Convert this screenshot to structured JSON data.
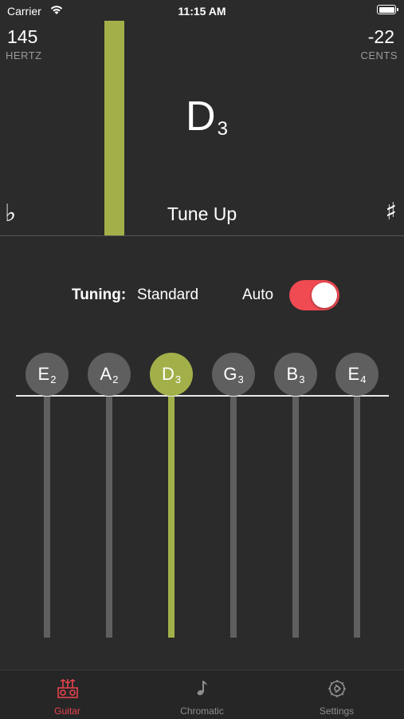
{
  "status_bar": {
    "carrier": "Carrier",
    "time": "11:15 AM"
  },
  "readout": {
    "hertz_value": "145",
    "hertz_label": "HERTZ",
    "cents_value": "-22",
    "cents_label": "CENTS",
    "note": "D",
    "note_octave": "3",
    "flat_symbol": "♭",
    "sharp_symbol": "♯",
    "tune_status": "Tune Up"
  },
  "tuning": {
    "label": "Tuning:",
    "value": "Standard",
    "auto_label": "Auto",
    "auto_enabled": true
  },
  "strings": [
    {
      "note": "E",
      "octave": "2",
      "active": false
    },
    {
      "note": "A",
      "octave": "2",
      "active": false
    },
    {
      "note": "D",
      "octave": "3",
      "active": true
    },
    {
      "note": "G",
      "octave": "3",
      "active": false
    },
    {
      "note": "B",
      "octave": "3",
      "active": false
    },
    {
      "note": "E",
      "octave": "4",
      "active": false
    }
  ],
  "tabs": [
    {
      "label": "Guitar",
      "icon": "guitar-headstock-icon",
      "active": true
    },
    {
      "label": "Chromatic",
      "icon": "music-note-icon",
      "active": false
    },
    {
      "label": "Settings",
      "icon": "gear-icon",
      "active": false
    }
  ],
  "colors": {
    "background": "#2b2b2b",
    "accent_green": "#a3b049",
    "toggle_red": "#f04a52",
    "tab_active": "#e8434e",
    "string_gray": "#5f5f5f"
  }
}
